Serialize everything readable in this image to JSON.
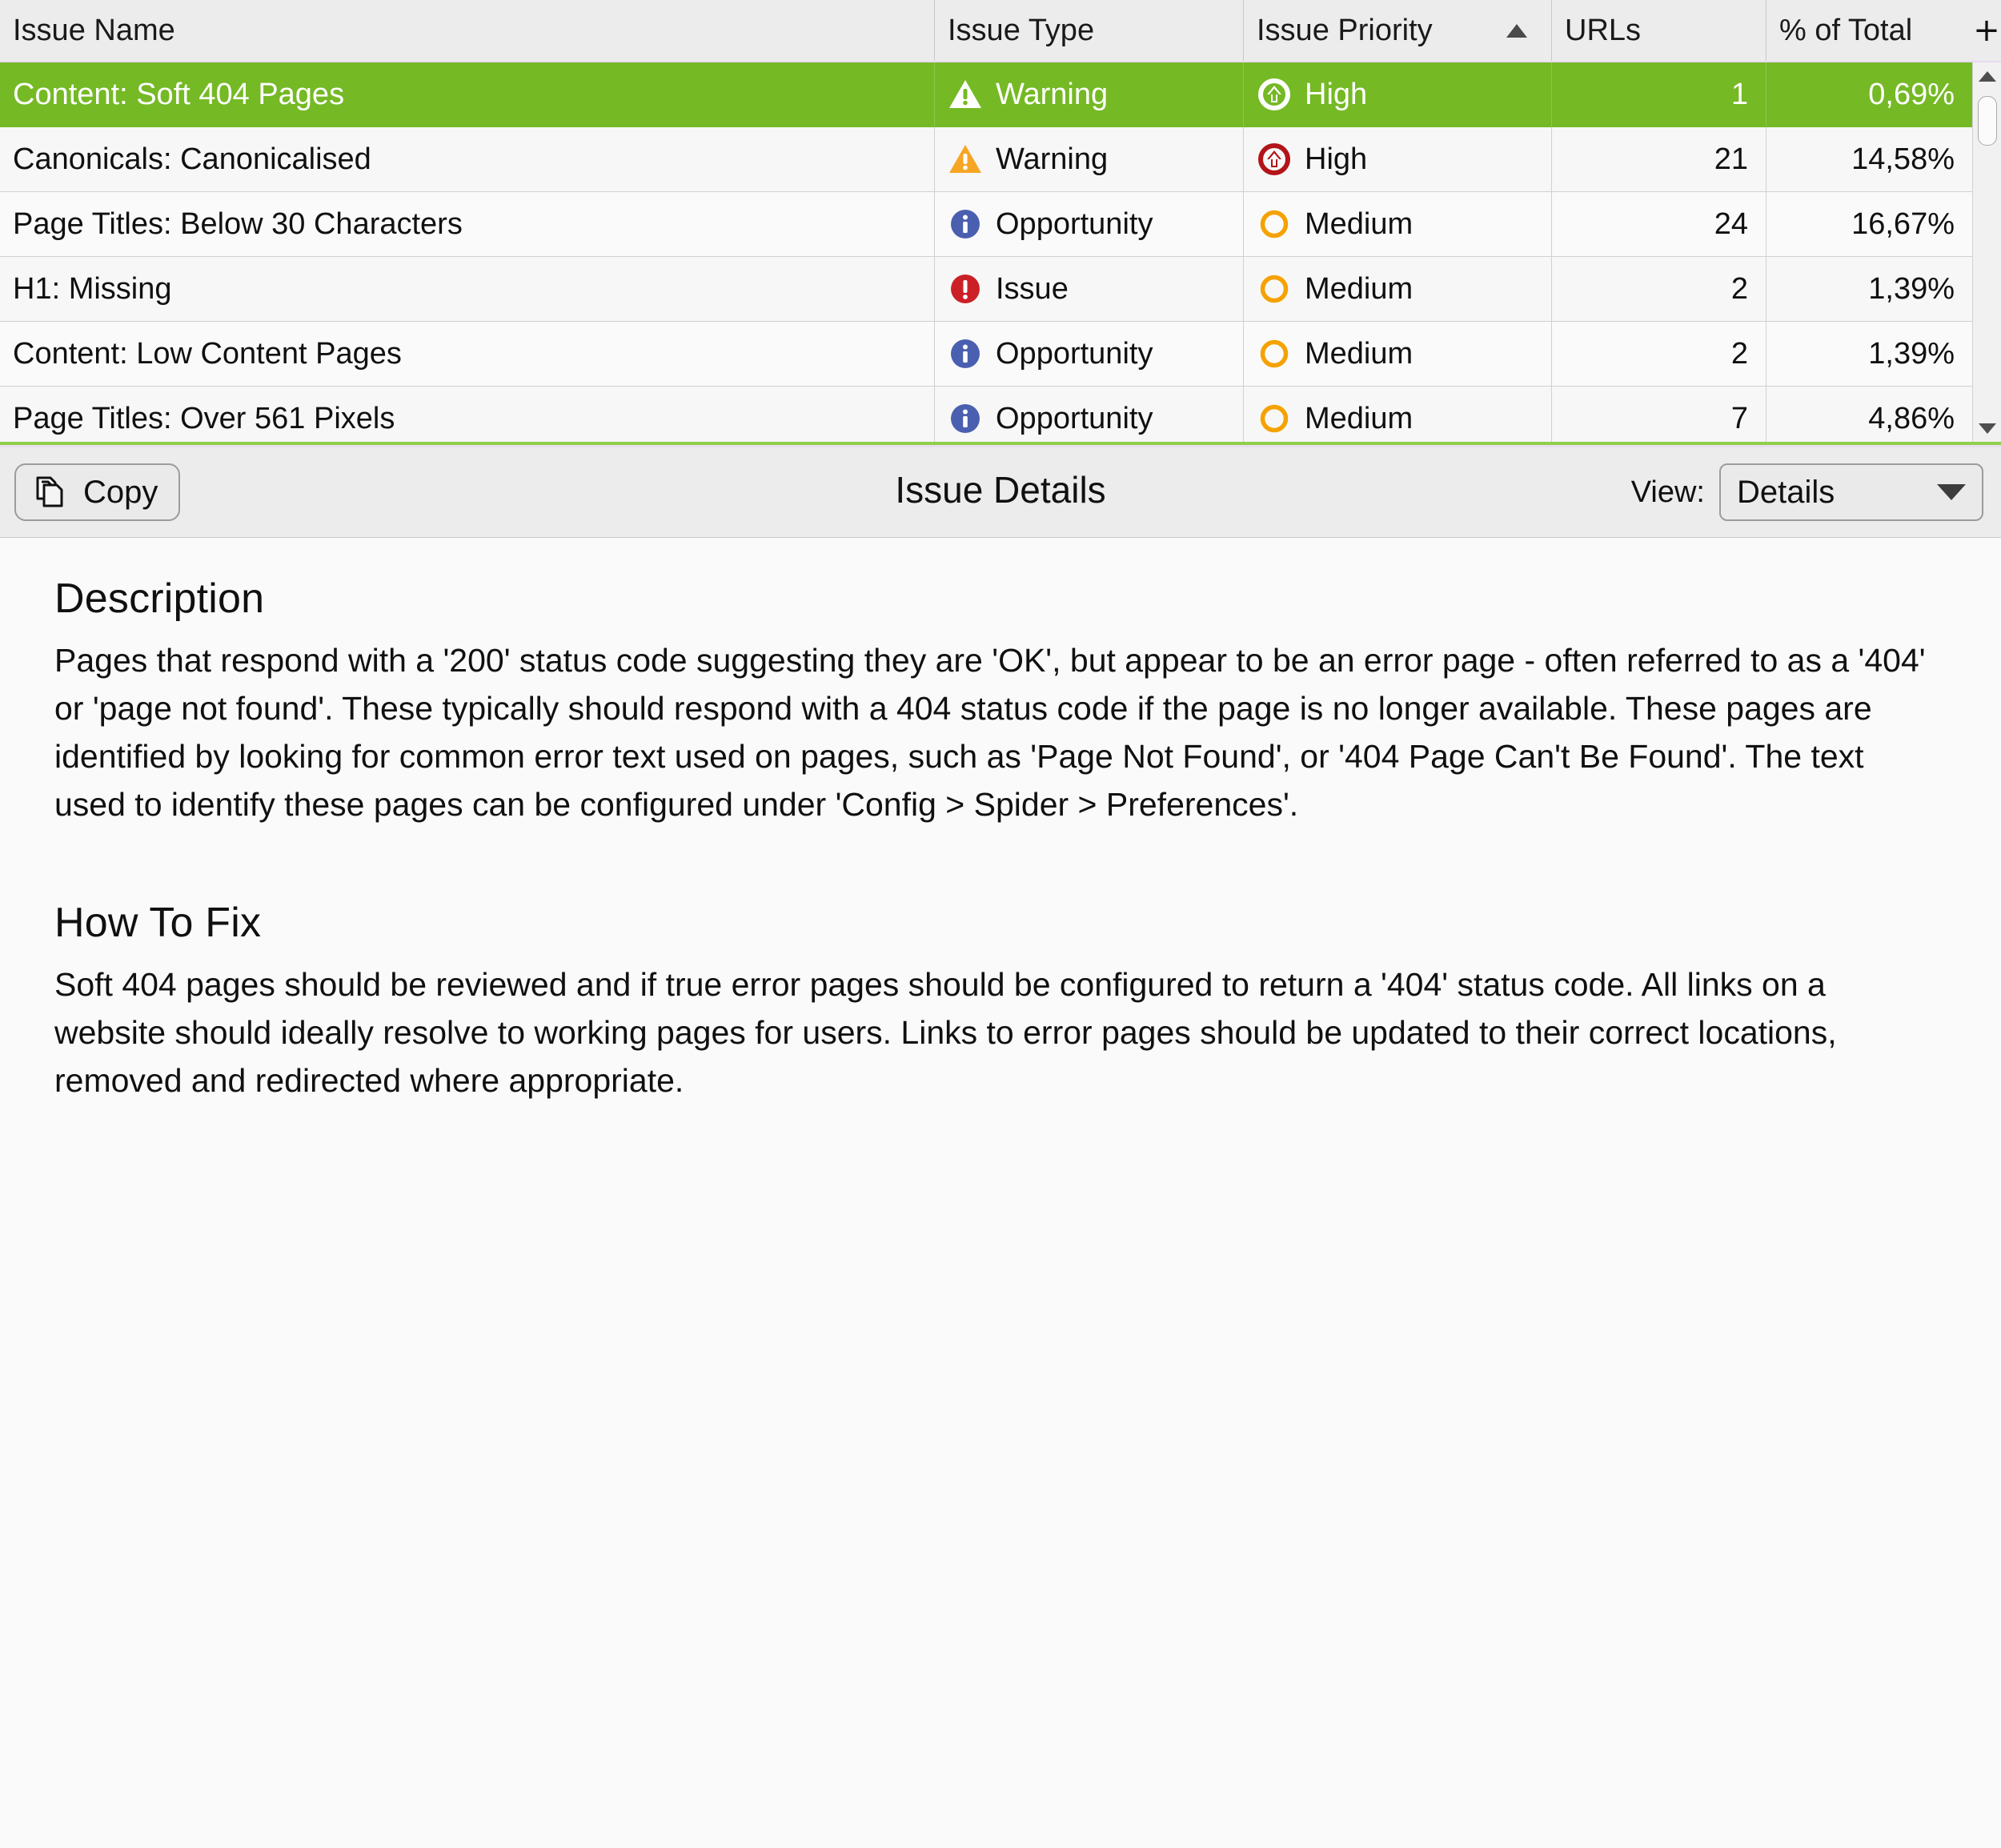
{
  "table": {
    "columns": [
      {
        "key": "issue_name",
        "label": "Issue Name",
        "sorted": false
      },
      {
        "key": "issue_type",
        "label": "Issue Type",
        "sorted": false
      },
      {
        "key": "issue_priority",
        "label": "Issue Priority",
        "sorted": true,
        "sort_direction": "ascending"
      },
      {
        "key": "urls",
        "label": "URLs",
        "sorted": false
      },
      {
        "key": "pct_of_total",
        "label": "% of Total",
        "sorted": false
      }
    ],
    "add_column_button": "+",
    "rows": [
      {
        "issue_name": "Content: Soft 404 Pages",
        "issue_type": "Warning",
        "issue_type_icon": "warning-triangle-icon",
        "issue_priority": "High",
        "issue_priority_icon": "priority-high-icon",
        "urls": "1",
        "pct_of_total": "0,69%",
        "selected": true
      },
      {
        "issue_name": "Canonicals: Canonicalised",
        "issue_type": "Warning",
        "issue_type_icon": "warning-triangle-icon",
        "issue_priority": "High",
        "issue_priority_icon": "priority-high-icon",
        "urls": "21",
        "pct_of_total": "14,58%",
        "selected": false
      },
      {
        "issue_name": "Page Titles: Below 30 Characters",
        "issue_type": "Opportunity",
        "issue_type_icon": "opportunity-info-icon",
        "issue_priority": "Medium",
        "issue_priority_icon": "priority-medium-icon",
        "urls": "24",
        "pct_of_total": "16,67%",
        "selected": false
      },
      {
        "issue_name": "H1: Missing",
        "issue_type": "Issue",
        "issue_type_icon": "issue-error-icon",
        "issue_priority": "Medium",
        "issue_priority_icon": "priority-medium-icon",
        "urls": "2",
        "pct_of_total": "1,39%",
        "selected": false
      },
      {
        "issue_name": "Content: Low Content Pages",
        "issue_type": "Opportunity",
        "issue_type_icon": "opportunity-info-icon",
        "issue_priority": "Medium",
        "issue_priority_icon": "priority-medium-icon",
        "urls": "2",
        "pct_of_total": "1,39%",
        "selected": false
      },
      {
        "issue_name": "Page Titles: Over 561 Pixels",
        "issue_type": "Opportunity",
        "issue_type_icon": "opportunity-info-icon",
        "issue_priority": "Medium",
        "issue_priority_icon": "priority-medium-icon",
        "urls": "7",
        "pct_of_total": "4,86%",
        "selected": false
      }
    ]
  },
  "details_toolbar": {
    "copy_label": "Copy",
    "copy_icon": "copy-pages-icon",
    "title": "Issue Details",
    "view_label": "View:",
    "view_value": "Details",
    "view_options": [
      "Details"
    ]
  },
  "details": {
    "description_heading": "Description",
    "description_text": "Pages that respond with a '200' status code suggesting they are 'OK', but appear to be an error page - often referred to as a '404' or 'page not found'. These typically should respond with a 404 status code if the page is no longer available. These pages are identified by looking for common error text used on pages, such as 'Page Not Found', or '404 Page Can't Be Found'. The text used to identify these pages can be configured under 'Config > Spider > Preferences'.",
    "how_to_fix_heading": "How To Fix",
    "how_to_fix_text": "Soft 404 pages should be reviewed and if true error pages should be configured to return a '404' status code. All links on a website should ideally resolve to working pages for users. Links to error pages should be updated to their correct locations, removed and redirected where appropriate."
  },
  "colors": {
    "selection_green": "#75b925",
    "warning_amber": "#f6a623",
    "opportunity_blue": "#4a5fb0",
    "issue_red": "#cc2027",
    "priority_high_red": "#b31419",
    "priority_medium_orange": "#f5a200",
    "divider_green": "#8fcf4c"
  }
}
